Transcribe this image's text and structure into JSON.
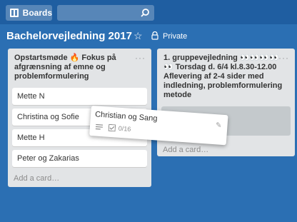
{
  "topbar": {
    "boards_label": "Boards",
    "search_placeholder": ""
  },
  "board": {
    "title": "Bachelorvejledning 2017",
    "visibility": "Private"
  },
  "lists": [
    {
      "title": "Opstartsmøde 🔥 Fokus på afgrænsning af emne og problemformulering",
      "menu": "···",
      "cards": [
        {
          "title": "Mette N"
        },
        {
          "title": "Christina og Sofie"
        },
        {
          "title": "Mette H"
        },
        {
          "title": "Peter og Zakarias"
        }
      ],
      "add_card": "Add a card…"
    },
    {
      "title": "1. gruppevejledning 👀👀👀👀👀 Torsdag d. 6/4 kl.8.30-12.00 Aflevering af 2-4 sider med indledning, problemformulering metode",
      "menu": "···",
      "add_card": "Add a card…"
    }
  ],
  "dragging_card": {
    "title": "Christian og Sang",
    "checklist": "0/16"
  }
}
